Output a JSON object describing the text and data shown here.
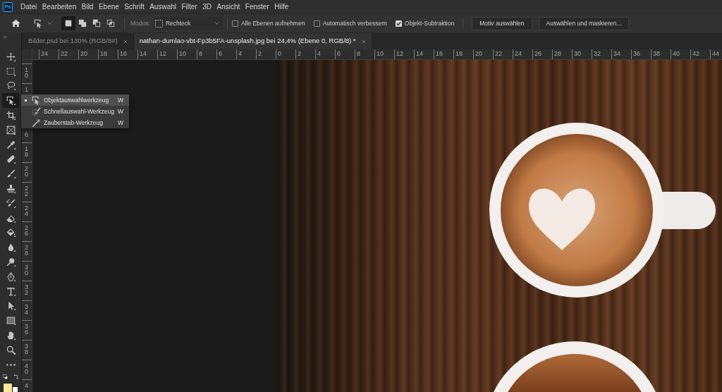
{
  "menu_bar": {
    "logo": "Ps",
    "items": [
      "Datei",
      "Bearbeiten",
      "Bild",
      "Ebene",
      "Schrift",
      "Auswahl",
      "Filter",
      "3D",
      "Ansicht",
      "Fenster",
      "Hilfe"
    ]
  },
  "options_bar": {
    "selection_modes": [
      {
        "kind": "new",
        "selected": true
      },
      {
        "kind": "add",
        "selected": false
      },
      {
        "kind": "subtract",
        "selected": false
      },
      {
        "kind": "intersect",
        "selected": false
      }
    ],
    "mode": {
      "label": "Modus:",
      "value": "Rechteck"
    },
    "checkboxes": [
      {
        "label": "Alle Ebenen aufnehmen",
        "checked": false
      },
      {
        "label": "Automatisch verbessern",
        "checked": false
      },
      {
        "label": "Objekt-Subtraktion",
        "checked": true
      }
    ],
    "buttons": [
      "Motiv auswählen",
      "Auswählen und maskieren..."
    ]
  },
  "document_tabs": [
    {
      "label": "Bilder.psd bei 130% (RGB/8#)",
      "selected": false
    },
    {
      "label": "nathan-dumlao-vbt-Fp3b5FA-unsplash.jpg bei 24,4% (Ebene 0, RGB/8) *",
      "selected": true
    }
  ],
  "tools": [
    {
      "kind": "move",
      "selected": false
    },
    {
      "kind": "marquee",
      "selected": false
    },
    {
      "kind": "lasso",
      "selected": false
    },
    {
      "kind": "object-selection",
      "selected": true
    },
    {
      "kind": "crop",
      "selected": false
    },
    {
      "kind": "frame",
      "selected": false
    },
    {
      "kind": "eyedropper",
      "selected": false
    },
    {
      "kind": "healing",
      "selected": false
    },
    {
      "kind": "brush",
      "selected": false
    },
    {
      "kind": "stamp",
      "selected": false
    },
    {
      "kind": "history-brush",
      "selected": false
    },
    {
      "kind": "eraser",
      "selected": false
    },
    {
      "kind": "bucket",
      "selected": false
    },
    {
      "kind": "blur",
      "selected": false
    },
    {
      "kind": "dodge",
      "selected": false
    },
    {
      "kind": "pen",
      "selected": false
    },
    {
      "kind": "type",
      "selected": false
    },
    {
      "kind": "path-select",
      "selected": false
    },
    {
      "kind": "rectangle",
      "selected": false
    },
    {
      "kind": "hand",
      "selected": false
    },
    {
      "kind": "zoom",
      "selected": false
    },
    {
      "kind": "more",
      "selected": false
    }
  ],
  "colors": [
    {
      "kind": "foreground",
      "color": "#fce79a"
    },
    {
      "kind": "background",
      "color": "#ffffff"
    }
  ],
  "horizontal_ruler": [
    "24",
    "22",
    "20",
    "18",
    "16",
    "14",
    "12",
    "10",
    "8",
    "6",
    "4",
    "2",
    "0",
    "2",
    "4",
    "6",
    "8",
    "10",
    "12",
    "14",
    "16",
    "18",
    "20",
    "22",
    "24",
    "26",
    "28",
    "30",
    "32",
    "34",
    "36",
    "38",
    "40",
    "42",
    "44"
  ],
  "vertical_ruler": [
    {
      "text": "10",
      "kind": "full"
    },
    {
      "text": "1",
      "kind": "head"
    },
    {
      "text": "6",
      "kind": "tail"
    },
    {
      "text": "18",
      "kind": "full"
    },
    {
      "text": "20",
      "kind": "full"
    },
    {
      "text": "22",
      "kind": "full"
    },
    {
      "text": "24",
      "kind": "full"
    },
    {
      "text": "26",
      "kind": "full"
    },
    {
      "text": "28",
      "kind": "full"
    },
    {
      "text": "30",
      "kind": "full"
    },
    {
      "text": "32",
      "kind": "full"
    },
    {
      "text": "34",
      "kind": "full"
    },
    {
      "text": "36",
      "kind": "full"
    },
    {
      "text": "38",
      "kind": "full"
    },
    {
      "text": "40",
      "kind": "full"
    },
    {
      "text": "4",
      "kind": "full"
    }
  ],
  "tool_flyout": [
    {
      "kind": "object-selection",
      "label": "Objektauswahlwerkzeug",
      "shortcut": "W",
      "selected": true
    },
    {
      "kind": "quick-selection",
      "label": "Schnellauswahl-Werkzeug",
      "shortcut": "W",
      "selected": false
    },
    {
      "kind": "magic-wand",
      "label": "Zauberstab-Werkzeug",
      "shortcut": "W",
      "selected": false
    }
  ]
}
